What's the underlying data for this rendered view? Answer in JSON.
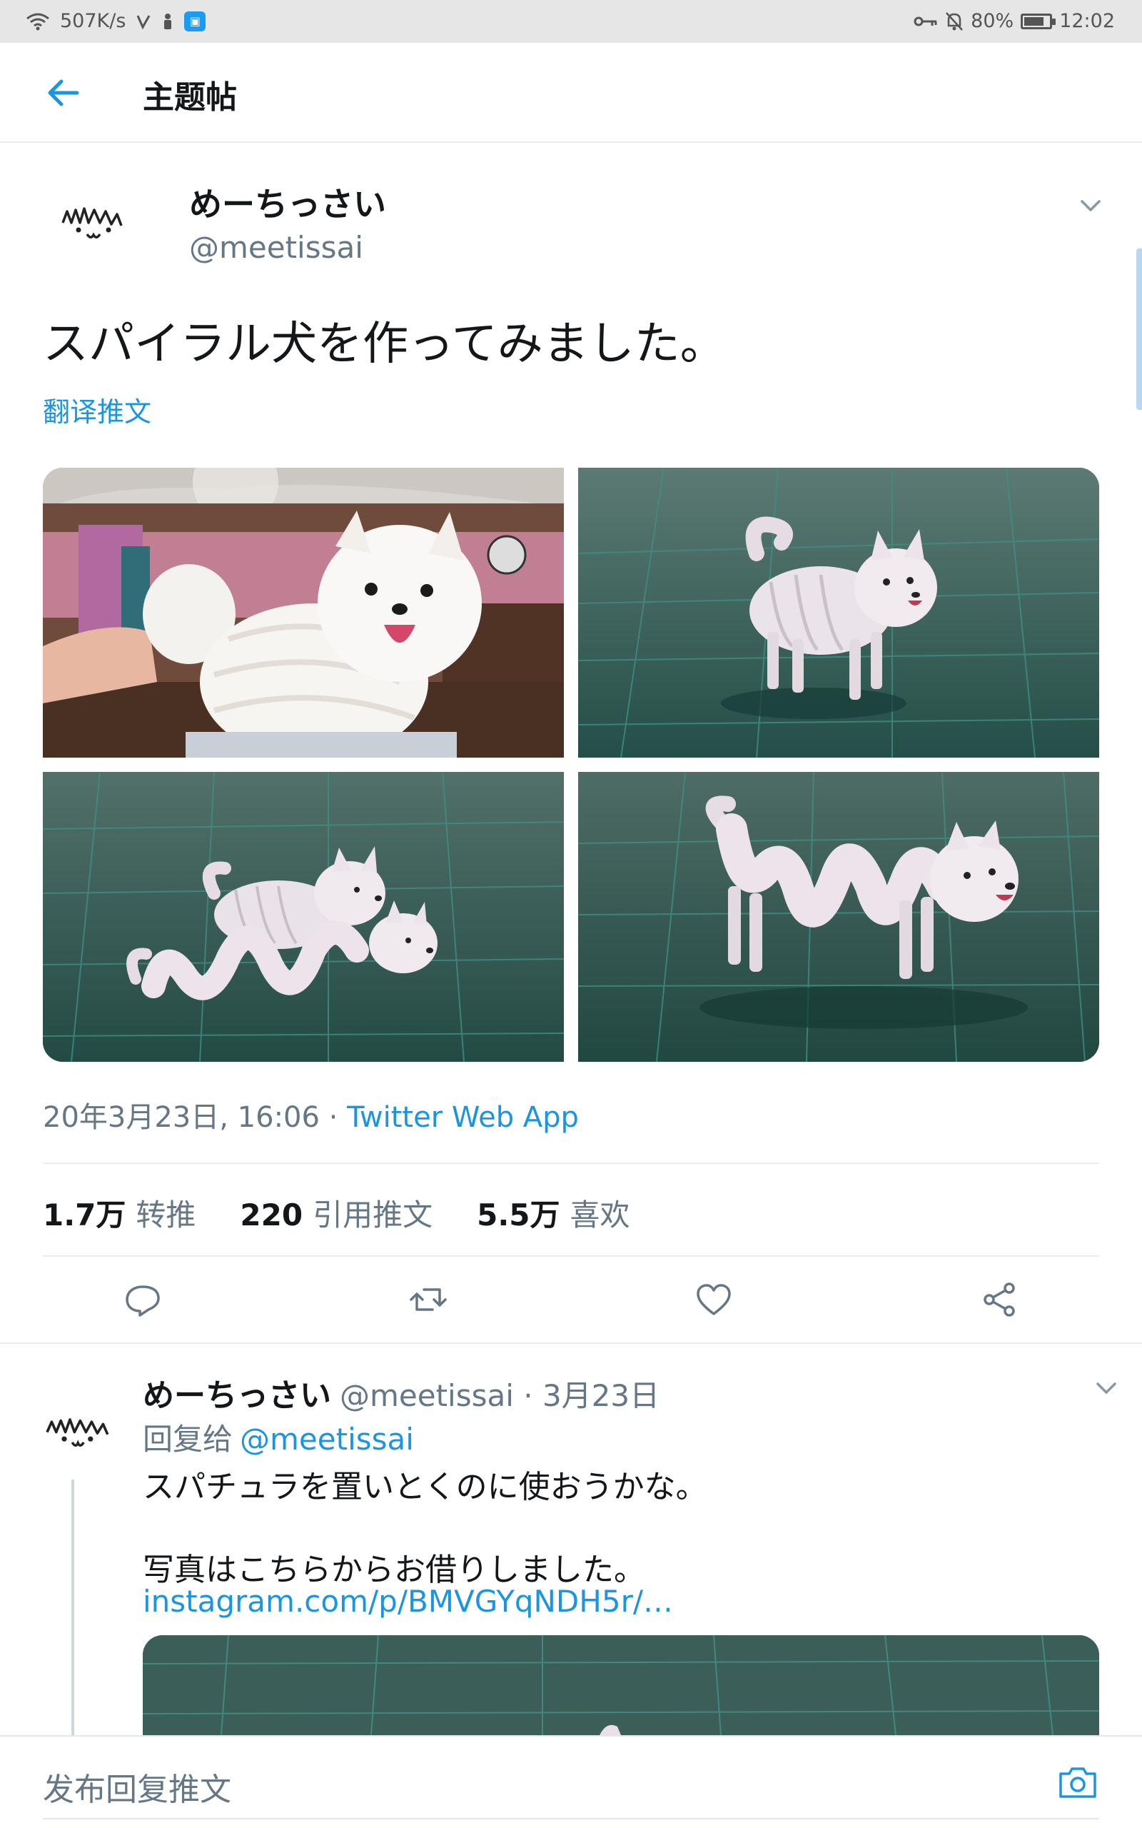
{
  "status_bar": {
    "net_speed": "507K/s",
    "battery": "80%",
    "battery_level": 0.8,
    "time": "12:02"
  },
  "header": {
    "title": "主题帖"
  },
  "tweet": {
    "name": "めーちっさい",
    "handle": "@meetissai",
    "text": "スパイラル犬を作ってみました。",
    "translate": "翻译推文",
    "timestamp": "20年3月23日, 16:06 · ",
    "source": "Twitter Web App",
    "stats": {
      "retweets_count": "1.7万",
      "retweets_label": "转推",
      "quotes_count": "220",
      "quotes_label": "引用推文",
      "likes_count": "5.5万",
      "likes_label": "喜欢"
    },
    "actions": [
      "reply-icon",
      "retweet-icon",
      "like-icon",
      "share-icon"
    ]
  },
  "reply": {
    "name": "めーちっさい",
    "meta": "@meetissai · 3月23日",
    "reply_to_label": "回复给",
    "reply_to_mention": "@meetissai",
    "line1": "スパチュラを置いとくのに使おうかな。",
    "line2": "写真はこちらからお借りしました。",
    "link": "instagram.com/p/BMVGYqNDH5r/…"
  },
  "compose": {
    "placeholder": "发布回复推文"
  },
  "colors": {
    "accent": "#1b95e0",
    "secondary_text": "#657786",
    "primary_text": "#14171a",
    "border": "#e6ecf0"
  }
}
